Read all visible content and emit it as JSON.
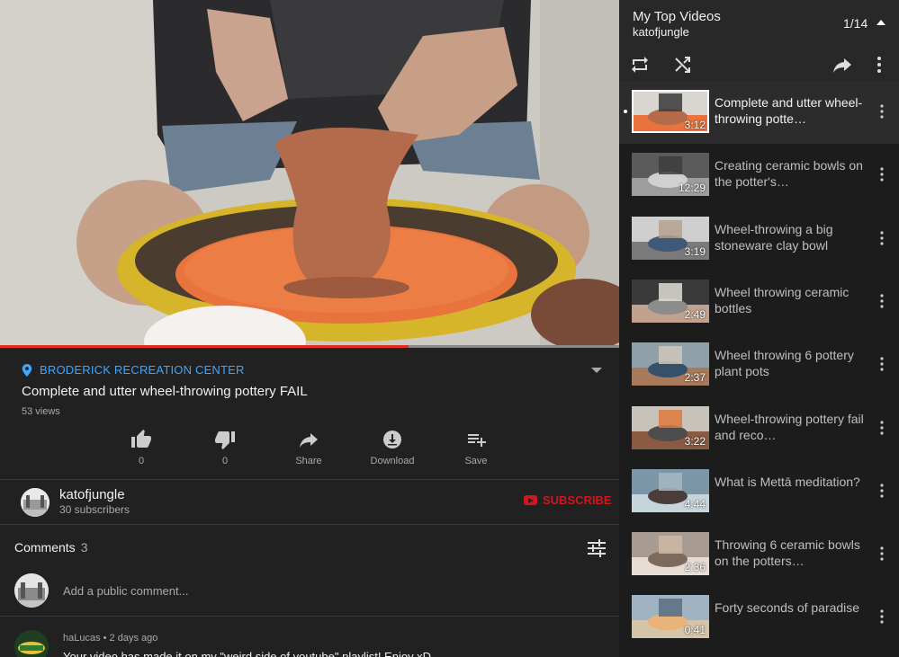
{
  "video": {
    "progress_fraction": 0.66
  },
  "info": {
    "location": "BRODERICK RECREATION CENTER",
    "title": "Complete and utter wheel-throwing pottery FAIL",
    "views": "53 views",
    "actions": [
      {
        "name": "like",
        "icon": "thumbs-up-icon",
        "label": "0"
      },
      {
        "name": "dislike",
        "icon": "thumbs-down-icon",
        "label": "0"
      },
      {
        "name": "share",
        "icon": "share-arrow-icon",
        "label": "Share"
      },
      {
        "name": "download",
        "icon": "download-icon",
        "label": "Download"
      },
      {
        "name": "save",
        "icon": "playlist-add-icon",
        "label": "Save"
      }
    ]
  },
  "channel": {
    "name": "katofjungle",
    "subscribers": "30 subscribers",
    "subscribe_label": "SUBSCRIBE"
  },
  "comments": {
    "heading": "Comments",
    "count": "3",
    "placeholder": "Add a public comment...",
    "items": [
      {
        "meta": "haLucas • 2 days ago",
        "text": "Your video has made it on my \"weird side of youtube\" playlist! Enjoy xD"
      }
    ]
  },
  "playlist": {
    "title": "My Top Videos",
    "owner": "katofjungle",
    "position": "1/14",
    "items": [
      {
        "title": "Complete and utter wheel-throwing potte…",
        "duration": "3:12",
        "active": true
      },
      {
        "title": "Creating ceramic bowls on the potter's…",
        "duration": "12:29"
      },
      {
        "title": "Wheel-throwing a big stoneware clay bowl",
        "duration": "3:19"
      },
      {
        "title": "Wheel throwing ceramic bottles",
        "duration": "2:49"
      },
      {
        "title": "Wheel throwing 6 pottery plant pots",
        "duration": "2:37"
      },
      {
        "title": "Wheel-throwing pottery fail and reco…",
        "duration": "3:22"
      },
      {
        "title": "What is Mettā meditation?",
        "duration": "4:44"
      },
      {
        "title": "Throwing 6 ceramic bowls on the potters…",
        "duration": "2:36"
      },
      {
        "title": "Forty seconds of paradise",
        "duration": "0:41"
      }
    ]
  },
  "colors": {
    "accent_link": "#3ea6ff",
    "progress": "#e52d27",
    "subscribe": "#cc181e",
    "background": "#212121"
  }
}
